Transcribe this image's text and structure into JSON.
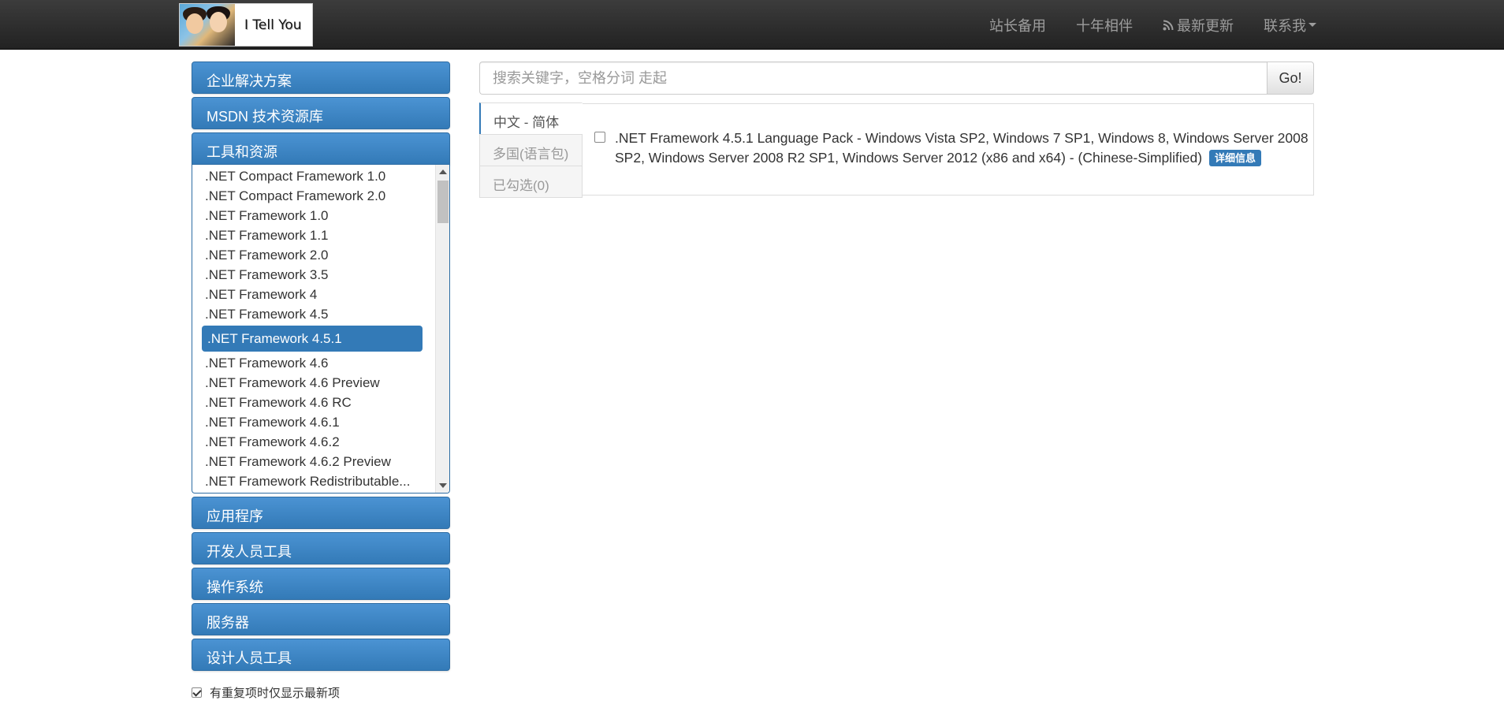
{
  "header": {
    "logo_text": "I Tell You",
    "nav": [
      {
        "label": "站长备用"
      },
      {
        "label": "十年相伴"
      },
      {
        "label": "最新更新",
        "icon": "rss-icon"
      },
      {
        "label": "联系我",
        "dropdown": true
      }
    ]
  },
  "sidebar": {
    "categories_top": [
      {
        "label": "企业解决方案"
      },
      {
        "label": "MSDN 技术资源库"
      },
      {
        "label": "工具和资源"
      }
    ],
    "open_list": [
      ".NET Compact Framework 1.0",
      ".NET Compact Framework 2.0",
      ".NET Framework 1.0",
      ".NET Framework 1.1",
      ".NET Framework 2.0",
      ".NET Framework 3.5",
      ".NET Framework 4",
      ".NET Framework 4.5",
      ".NET Framework 4.5.1",
      ".NET Framework 4.6",
      ".NET Framework 4.6 Preview",
      ".NET Framework 4.6 RC",
      ".NET Framework 4.6.1",
      ".NET Framework 4.6.2",
      ".NET Framework 4.6.2 Preview",
      ".NET Framework Redistributable..."
    ],
    "selected_item": ".NET Framework 4.5.1",
    "categories_bottom": [
      {
        "label": "应用程序"
      },
      {
        "label": "开发人员工具"
      },
      {
        "label": "操作系统"
      },
      {
        "label": "服务器"
      },
      {
        "label": "设计人员工具"
      }
    ],
    "checkbox_label": "有重复项时仅显示最新项",
    "checkbox_checked": true
  },
  "search": {
    "placeholder": "搜索关键字，空格分词 走起",
    "button_label": "Go!"
  },
  "content": {
    "tabs": [
      {
        "label": "中文 - 简体",
        "active": true
      },
      {
        "label": "多国(语言包)",
        "active": false
      },
      {
        "label": "已勾选(0)",
        "active": false
      }
    ],
    "files": [
      {
        "name": ".NET Framework 4.5.1 Language Pack - Windows Vista SP2, Windows 7 SP1, Windows 8, Windows Server 2008 SP2, Windows Server 2008 R2 SP1, Windows Server 2012 (x86 and x64) - (Chinese-Simplified)",
        "badge": "详细信息"
      }
    ]
  },
  "colors": {
    "primary": "#337ab7",
    "navbar": "#222222",
    "nav_text": "#9d9d9d"
  }
}
